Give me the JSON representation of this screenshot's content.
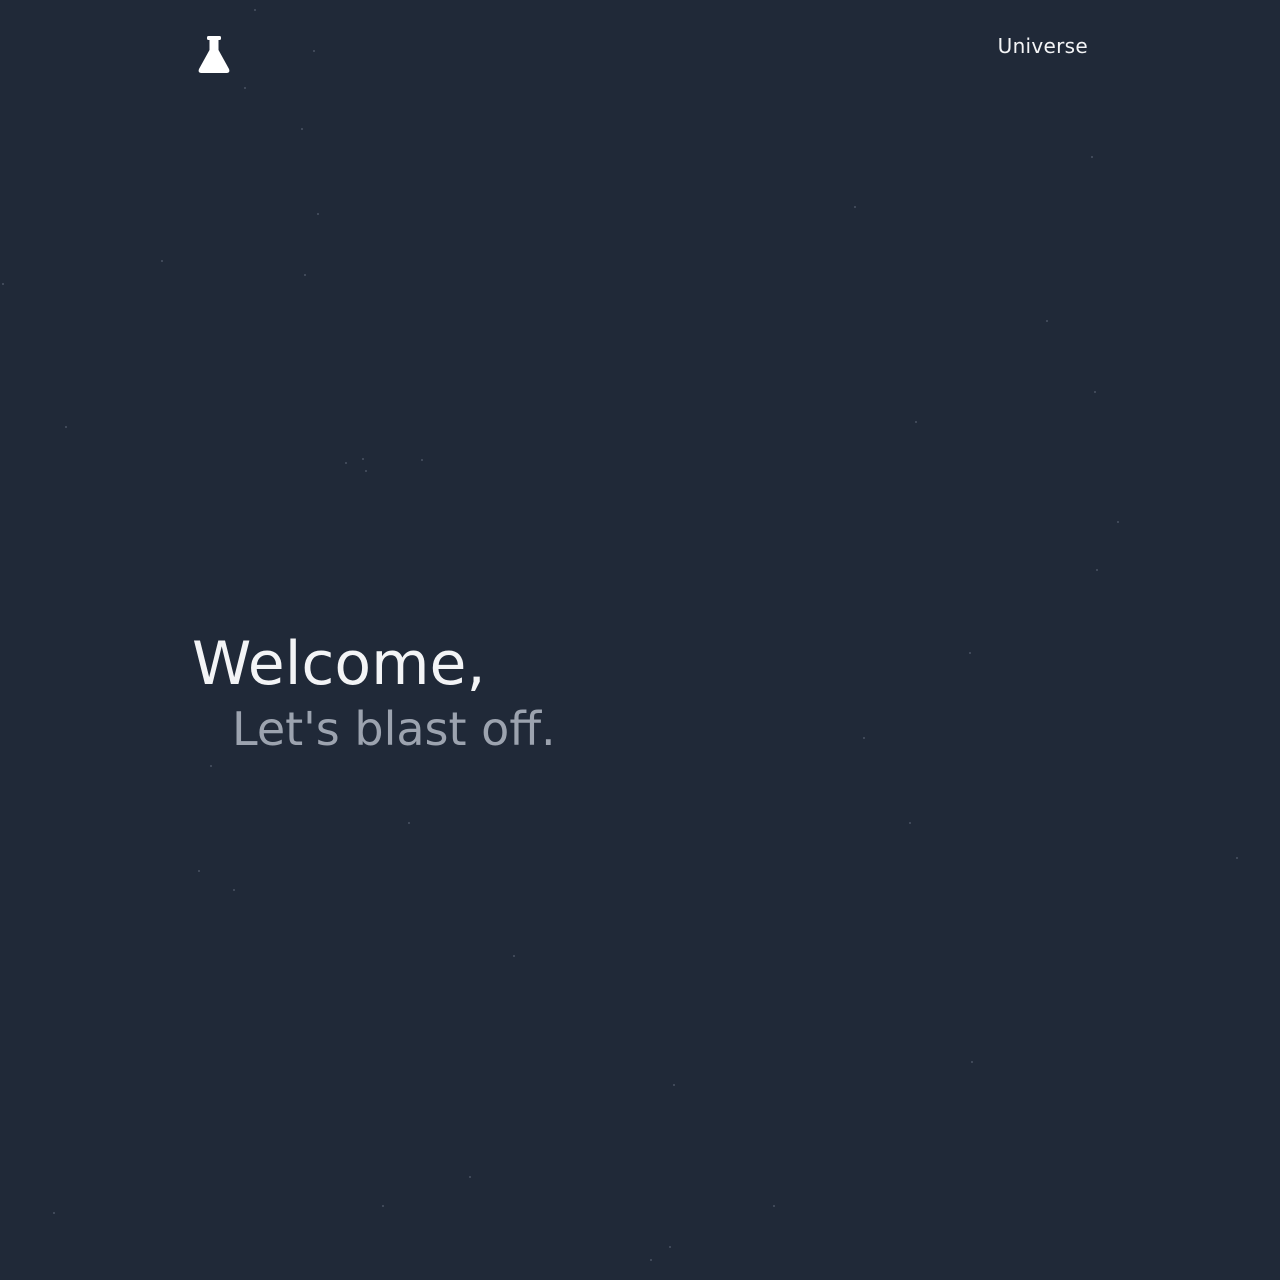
{
  "theme": {
    "background": "#202938",
    "text_primary": "#f3f4f6",
    "text_secondary": "#9ca3af"
  },
  "header": {
    "logo_icon": "flask-icon",
    "nav_link_label": "Universe"
  },
  "hero": {
    "title": "Welcome,",
    "subtitle": "Let's blast off."
  }
}
